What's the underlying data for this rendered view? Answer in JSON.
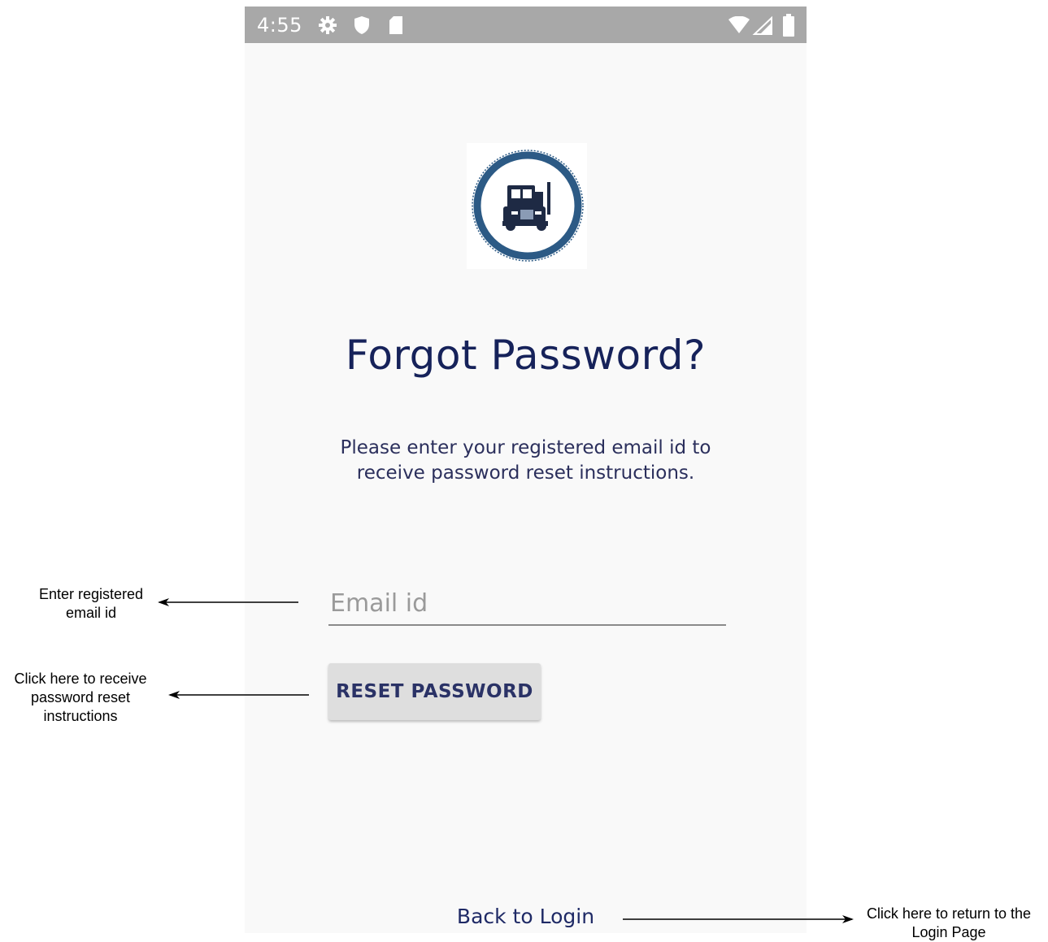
{
  "status_bar": {
    "time": "4:55",
    "left_icons": [
      "gear-icon",
      "shield-icon",
      "sd-card-icon"
    ],
    "right_icons": [
      "wifi-icon",
      "signal-icon",
      "battery-icon"
    ]
  },
  "logo": {
    "icon": "truck-logo-icon"
  },
  "screen": {
    "title": "Forgot Password?",
    "instructions_line1": "Please enter your registered email id to",
    "instructions_line2": "receive password reset instructions.",
    "email_placeholder": "Email id",
    "email_value": "",
    "reset_button_label": "RESET PASSWORD",
    "back_link_label": "Back to Login"
  },
  "annotations": {
    "email_line1": "Enter registered",
    "email_line2": "email id",
    "reset_line1": "Click here to receive",
    "reset_line2": "password reset",
    "reset_line3": "instructions",
    "back_line1": "Click here to return to the",
    "back_line2": "Login Page"
  },
  "colors": {
    "status_bar": "#a8a8a8",
    "screen_background": "#f9f9f9",
    "title_text": "#16225a",
    "logo_ring": "#2c5a85",
    "button_background": "#dedede"
  }
}
